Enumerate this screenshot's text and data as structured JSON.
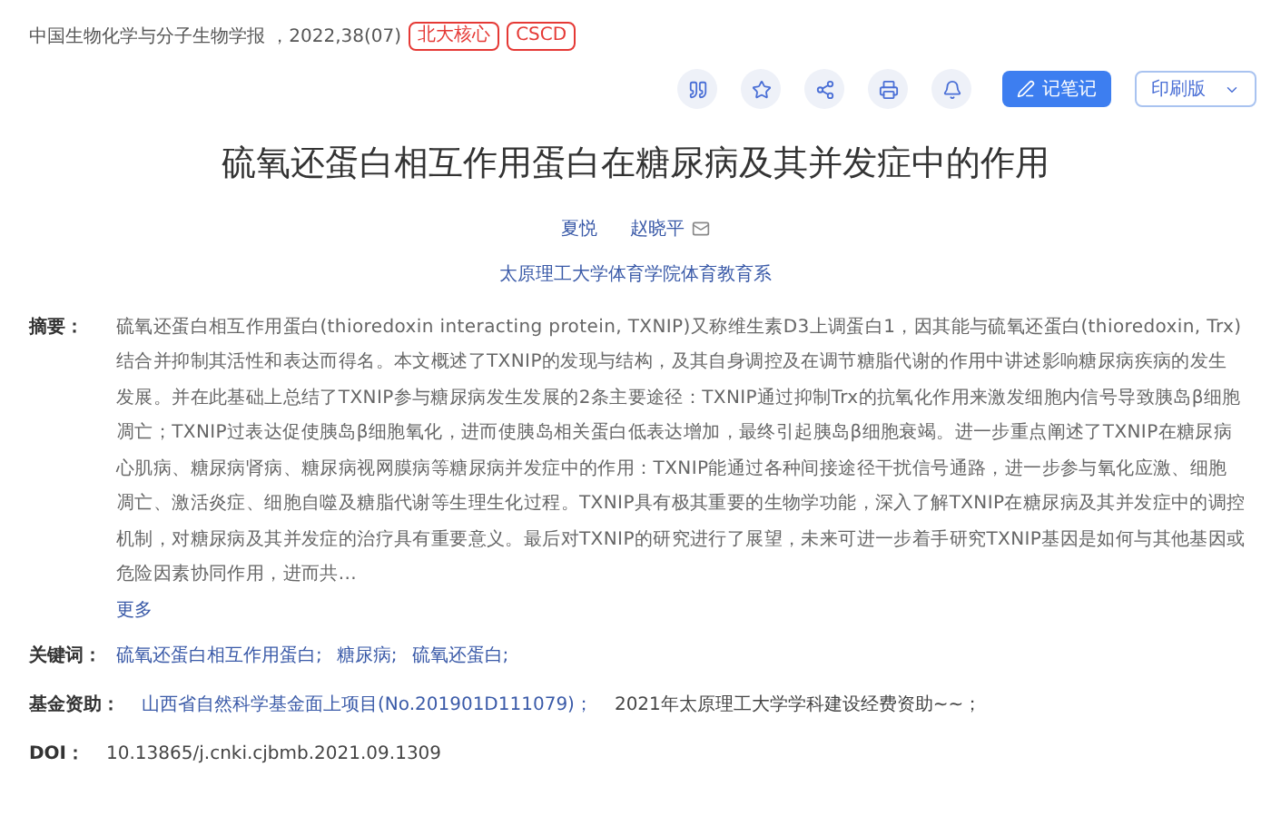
{
  "source": {
    "journal": "中国生物化学与分子生物学报 ，2022,38(07)",
    "badges": [
      "北大核心",
      "CSCD"
    ]
  },
  "toolbar": {
    "note_button": "记笔记",
    "edition_select": "印刷版"
  },
  "title": "硫氧还蛋白相互作用蛋白在糖尿病及其并发症中的作用",
  "authors": [
    {
      "name": "夏悦",
      "mail": false
    },
    {
      "name": "赵晓平",
      "mail": true
    }
  ],
  "affiliation": "太原理工大学体育学院体育教育系",
  "abstract": {
    "label": "摘要：",
    "text": "硫氧还蛋白相互作用蛋白(thioredoxin interacting protein, TXNIP)又称维生素D3上调蛋白1，因其能与硫氧还蛋白(thioredoxin, Trx)结合并抑制其活性和表达而得名。本文概述了TXNIP的发现与结构，及其自身调控及在调节糖脂代谢的作用中讲述影响糖尿病疾病的发生发展。并在此基础上总结了TXNIP参与糖尿病发生发展的2条主要途径：TXNIP通过抑制Trx的抗氧化作用来激发细胞内信号导致胰岛β细胞凋亡；TXNIP过表达促使胰岛β细胞氧化，进而使胰岛相关蛋白低表达增加，最终引起胰岛β细胞衰竭。进一步重点阐述了TXNIP在糖尿病心肌病、糖尿病肾病、糖尿病视网膜病等糖尿病并发症中的作用：TXNIP能通过各种间接途径干扰信号通路，进一步参与氧化应激、细胞凋亡、激活炎症、细胞自噬及糖脂代谢等生理生化过程。TXNIP具有极其重要的生物学功能，深入了解TXNIP在糖尿病及其并发症中的调控机制，对糖尿病及其并发症的治疗具有重要意义。最后对TXNIP的研究进行了展望，未来可进一步着手研究TXNIP基因是如何与其他基因或危险因素协同作用，进而共...",
    "more": "更多"
  },
  "keywords": {
    "label": "关键词：",
    "items": [
      "硫氧还蛋白相互作用蛋白;",
      "糖尿病;",
      "硫氧还蛋白;"
    ]
  },
  "funding": {
    "label": "基金资助：",
    "items": [
      "山西省自然科学基金面上项目(No.201901D111079)；",
      "2021年太原理工大学学科建设经费资助~~；"
    ]
  },
  "doi": {
    "label": "DOI：",
    "value": "10.13865/j.cnki.cjbmb.2021.09.1309"
  }
}
